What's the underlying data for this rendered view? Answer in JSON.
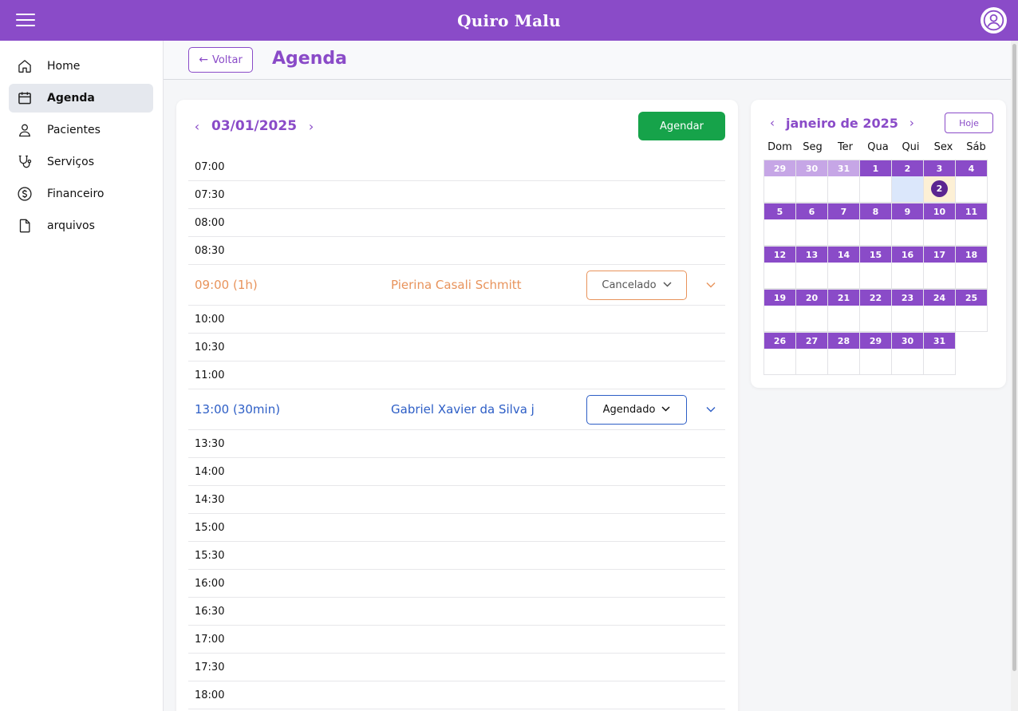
{
  "app": {
    "title": "Quiro Malu"
  },
  "sidebar": {
    "items": [
      {
        "label": "Home",
        "icon": "home-icon",
        "active": false
      },
      {
        "label": "Agenda",
        "icon": "calendar-icon",
        "active": true
      },
      {
        "label": "Pacientes",
        "icon": "user-icon",
        "active": false
      },
      {
        "label": "Serviços",
        "icon": "stethoscope-icon",
        "active": false
      },
      {
        "label": "Financeiro",
        "icon": "dollar-circle-icon",
        "active": false
      },
      {
        "label": "arquivos",
        "icon": "file-icon",
        "active": false
      }
    ]
  },
  "page": {
    "back_label": "Voltar",
    "title": "Agenda"
  },
  "day": {
    "date": "03/01/2025",
    "agendar_label": "Agendar",
    "slots": [
      {
        "time": "07:00"
      },
      {
        "time": "07:30"
      },
      {
        "time": "08:00"
      },
      {
        "time": "08:30"
      },
      {
        "time": "09:00 (1h)",
        "patient": "Pierina Casali Schmitt",
        "status": "Cancelado",
        "kind": "cancel"
      },
      {
        "time": "10:00"
      },
      {
        "time": "10:30"
      },
      {
        "time": "11:00"
      },
      {
        "time": "13:00 (30min)",
        "patient": "Gabriel Xavier da Silva j",
        "status": "Agendado",
        "kind": "sched"
      },
      {
        "time": "13:30"
      },
      {
        "time": "14:00"
      },
      {
        "time": "14:30"
      },
      {
        "time": "15:00"
      },
      {
        "time": "15:30"
      },
      {
        "time": "16:00"
      },
      {
        "time": "16:30"
      },
      {
        "time": "17:00"
      },
      {
        "time": "17:30"
      },
      {
        "time": "18:00"
      }
    ]
  },
  "calendar": {
    "month_label": "janeiro de 2025",
    "today_label": "Hoje",
    "weekdays": [
      "Dom",
      "Seg",
      "Ter",
      "Qua",
      "Qui",
      "Sex",
      "Sáb"
    ],
    "weeks": [
      [
        {
          "d": "29",
          "other": true
        },
        {
          "d": "30",
          "other": true
        },
        {
          "d": "31",
          "other": true
        },
        {
          "d": "1"
        },
        {
          "d": "2",
          "today": true
        },
        {
          "d": "3",
          "count": "2"
        },
        {
          "d": "4"
        }
      ],
      [
        {
          "d": "5"
        },
        {
          "d": "6"
        },
        {
          "d": "7"
        },
        {
          "d": "8"
        },
        {
          "d": "9"
        },
        {
          "d": "10"
        },
        {
          "d": "11"
        }
      ],
      [
        {
          "d": "12"
        },
        {
          "d": "13"
        },
        {
          "d": "14"
        },
        {
          "d": "15"
        },
        {
          "d": "16"
        },
        {
          "d": "17"
        },
        {
          "d": "18"
        }
      ],
      [
        {
          "d": "19"
        },
        {
          "d": "20"
        },
        {
          "d": "21"
        },
        {
          "d": "22"
        },
        {
          "d": "23"
        },
        {
          "d": "24"
        },
        {
          "d": "25"
        }
      ],
      [
        {
          "d": "26"
        },
        {
          "d": "27"
        },
        {
          "d": "28"
        },
        {
          "d": "29"
        },
        {
          "d": "30"
        },
        {
          "d": "31"
        },
        {
          "d": "",
          "empty": true
        }
      ]
    ]
  },
  "colors": {
    "brand": "#8a4bc8",
    "success": "#16a34a",
    "cancel": "#e8935b",
    "scheduled": "#2d5ec6"
  }
}
